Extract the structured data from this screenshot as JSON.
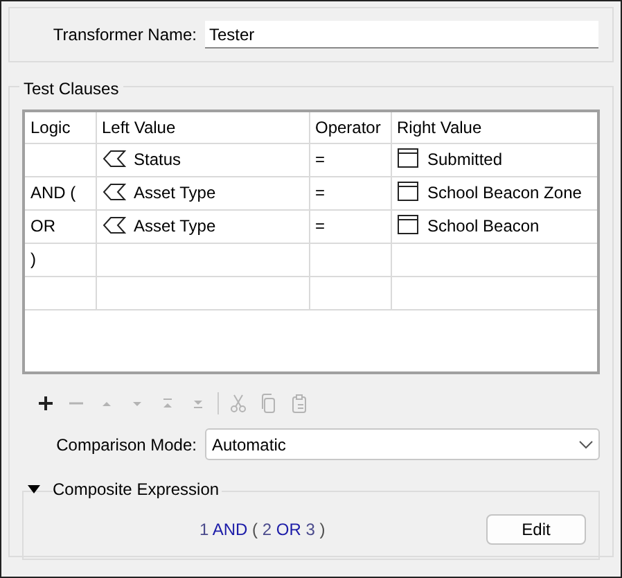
{
  "transformer_name": {
    "label": "Transformer Name:",
    "value": "Tester"
  },
  "test_clauses": {
    "title": "Test Clauses",
    "columns": [
      "Logic",
      "Left Value",
      "Operator",
      "Right Value"
    ],
    "rows": [
      {
        "logic": "",
        "left_value": "Status",
        "operator": "=",
        "right_value": "Submitted"
      },
      {
        "logic": "AND (",
        "left_value": "Asset Type",
        "operator": "=",
        "right_value": "School Beacon Zone"
      },
      {
        "logic": "OR",
        "left_value": "Asset Type",
        "operator": "=",
        "right_value": "School Beacon"
      },
      {
        "logic": ")"
      },
      {}
    ],
    "toolbar": [
      {
        "kind": "add",
        "disabled": false
      },
      {
        "kind": "remove",
        "disabled": true
      },
      {
        "kind": "up",
        "disabled": true
      },
      {
        "kind": "down",
        "disabled": true
      },
      {
        "kind": "top",
        "disabled": true
      },
      {
        "kind": "bottom",
        "disabled": true
      },
      {
        "kind": "separator"
      },
      {
        "kind": "cut",
        "disabled": true
      },
      {
        "kind": "copy",
        "disabled": true
      },
      {
        "kind": "paste",
        "disabled": true
      }
    ],
    "comparison_mode": {
      "label": "Comparison Mode:",
      "value": "Automatic"
    },
    "composite_expression": {
      "title": "Composite Expression",
      "expanded": true,
      "tokens": [
        {
          "text": "1",
          "kind": "number"
        },
        {
          "text": "AND",
          "kind": "operator"
        },
        {
          "text": "(",
          "kind": "paren"
        },
        {
          "text": "2",
          "kind": "number"
        },
        {
          "text": "OR",
          "kind": "operator"
        },
        {
          "text": "3",
          "kind": "number"
        },
        {
          "text": ")",
          "kind": "paren"
        }
      ],
      "button": "Edit"
    }
  }
}
